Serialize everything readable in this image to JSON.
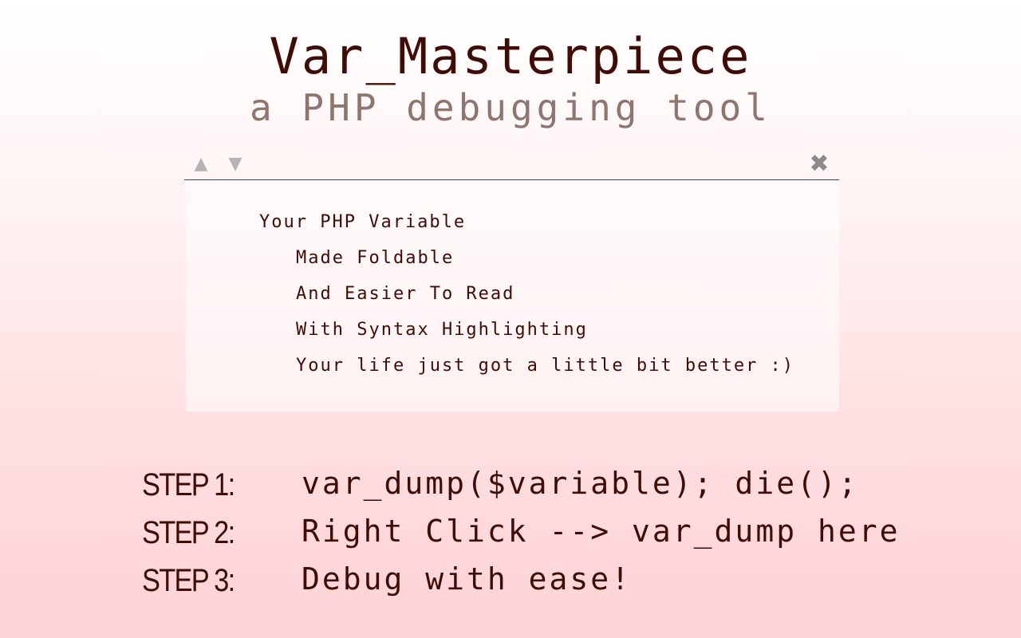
{
  "header": {
    "title": "Var_Masterpiece",
    "subtitle": "a PHP debugging tool"
  },
  "panel": {
    "toolbar": {
      "up_icon": "triangle-up-icon",
      "down_icon": "triangle-down-icon",
      "close_icon": "close-icon",
      "up_glyph": "▲",
      "down_glyph": "▼",
      "close_glyph": "✖"
    },
    "tree": {
      "root": "Your PHP Variable",
      "children": [
        "Made Foldable",
        "And Easier To Read",
        "With Syntax Highlighting",
        "Your life just got a little bit better :)"
      ]
    }
  },
  "steps": [
    {
      "label": "STEP 1:",
      "text": "var_dump($variable); die();"
    },
    {
      "label": "STEP 2:",
      "text": "Right Click --> var_dump here"
    },
    {
      "label": "STEP 3:",
      "text": "Debug with ease!"
    }
  ],
  "colors": {
    "text": "#3f0c08",
    "subtitle": "#8f7570",
    "toolbar_icon": "#b8b3b3",
    "close_icon": "#8e8a8a",
    "background_bottom": "#fdd3d6"
  }
}
